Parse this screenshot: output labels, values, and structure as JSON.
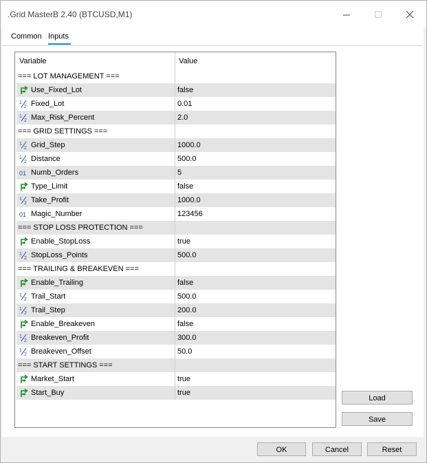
{
  "window": {
    "title": ".Grid MasterB 2.40 (BTCUSD,M1)"
  },
  "tabs": [
    {
      "label": "Common"
    },
    {
      "label": "Inputs"
    }
  ],
  "grid": {
    "columns": {
      "variable": "Variable",
      "value": "Value"
    },
    "rows": [
      {
        "type": "section",
        "name": "=== LOT MANAGEMENT ===",
        "value": "",
        "icon": ""
      },
      {
        "type": "bool",
        "name": "Use_Fixed_Lot",
        "value": "false",
        "icon": "bool-arrow-icon"
      },
      {
        "type": "double",
        "name": "Fixed_Lot",
        "value": "0.01",
        "icon": "half-icon"
      },
      {
        "type": "double",
        "name": "Max_Risk_Percent",
        "value": "2.0",
        "icon": "half-icon"
      },
      {
        "type": "section",
        "name": "=== GRID SETTINGS ===",
        "value": "",
        "icon": ""
      },
      {
        "type": "double",
        "name": "Grid_Step",
        "value": "1000.0",
        "icon": "half-icon"
      },
      {
        "type": "double",
        "name": "Distance",
        "value": "500.0",
        "icon": "half-icon"
      },
      {
        "type": "int",
        "name": "Numb_Orders",
        "value": "5",
        "icon": "int-icon"
      },
      {
        "type": "bool",
        "name": "Type_Limit",
        "value": "false",
        "icon": "bool-arrow-icon"
      },
      {
        "type": "double",
        "name": "Take_Profit",
        "value": "1000.0",
        "icon": "half-icon"
      },
      {
        "type": "int",
        "name": "Magic_Number",
        "value": "123456",
        "icon": "int-icon"
      },
      {
        "type": "section",
        "name": "=== STOP LOSS PROTECTION ===",
        "value": "",
        "icon": ""
      },
      {
        "type": "bool",
        "name": "Enable_StopLoss",
        "value": "true",
        "icon": "bool-arrow-icon"
      },
      {
        "type": "double",
        "name": "StopLoss_Points",
        "value": "500.0",
        "icon": "half-icon"
      },
      {
        "type": "section",
        "name": "=== TRAILING & BREAKEVEN ===",
        "value": "",
        "icon": ""
      },
      {
        "type": "bool",
        "name": "Enable_Trailing",
        "value": "false",
        "icon": "bool-arrow-icon"
      },
      {
        "type": "double",
        "name": "Trail_Start",
        "value": "500.0",
        "icon": "half-icon"
      },
      {
        "type": "double",
        "name": "Trail_Step",
        "value": "200.0",
        "icon": "half-icon"
      },
      {
        "type": "bool",
        "name": "Enable_Breakeven",
        "value": "false",
        "icon": "bool-arrow-icon"
      },
      {
        "type": "double",
        "name": "Breakeven_Profit",
        "value": "300.0",
        "icon": "half-icon"
      },
      {
        "type": "double",
        "name": "Breakeven_Offset",
        "value": "50.0",
        "icon": "half-icon"
      },
      {
        "type": "section",
        "name": "=== START SETTINGS ===",
        "value": "",
        "icon": ""
      },
      {
        "type": "bool",
        "name": "Market_Start",
        "value": "true",
        "icon": "bool-arrow-icon"
      },
      {
        "type": "bool",
        "name": "Start_Buy",
        "value": "true",
        "icon": "bool-arrow-icon"
      }
    ]
  },
  "side_buttons": {
    "load": "Load",
    "save": "Save"
  },
  "footer_buttons": {
    "ok": "OK",
    "cancel": "Cancel",
    "reset": "Reset"
  },
  "colors": {
    "accent": "#1b7fd6",
    "bool_icon": "#1a8a2a",
    "num_icon": "#1f4fb3",
    "row_shade": "#e4e4e4"
  }
}
